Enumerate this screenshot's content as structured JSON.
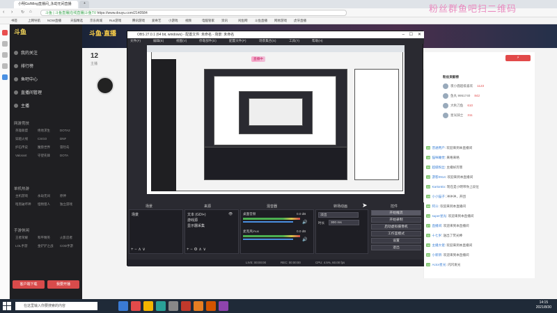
{
  "browser": {
    "tabs": [
      {
        "label": "小明Go/Ming直播间_永劫无间直播",
        "active": true
      },
      {
        "label": "",
        "active": false
      }
    ],
    "url": "https://www.douyu.com/2140584",
    "url_prefix": "斗鱼 | 斗鱼直播|在线直播|斗鱼TV",
    "bookmarks": [
      "书签",
      "上网导航",
      "NOW直播",
      "天猫精选",
      "京东商城",
      "Run游戏",
      "腾讯游戏",
      "爱奇艺",
      "小游戏",
      "视频",
      "电脑管家",
      "资讯",
      "闲鱼网",
      "斗鱼直播",
      "网易游戏",
      "虎牙直播"
    ],
    "watermark": "粉丝群鱼吧扫二维码"
  },
  "sidebar": {
    "items": [
      "我的关注",
      "排行榜",
      "鱼吧中心",
      "直播间管理",
      "主播"
    ],
    "sections": [
      "网游竞技",
      "单机热游",
      "手游休闲"
    ],
    "games_a": [
      "英雄联盟",
      "绝地求生",
      "DOTA2",
      "穿越火线",
      "CSGO",
      "DNF",
      "炉石传说",
      "魔兽世界",
      "冒险岛",
      "Valorant",
      "守望先锋",
      "DOTA"
    ],
    "games_b": [
      "主机游戏",
      "永劫无间",
      "原神",
      "暗黑破坏神",
      "怪物猎人",
      "独立游戏"
    ],
    "games_c": [
      "王者荣耀",
      "和平精英",
      "火影忍者",
      "LOL手游",
      "金铲铲之战",
      "COD手游"
    ],
    "btn_left": "客户端下载",
    "btn_right": "我要开播"
  },
  "page": {
    "banner_logo": "斗鱼·直播",
    "follower_count": "12",
    "streamer_tag": "主播",
    "rank_title": "粉丝贡献榜",
    "rank_rows": [
      "夜小鹿超级喜欢",
      "鱼丸 9951740",
      "大秋刀鱼",
      "星光骑士"
    ],
    "rank_scores": [
      "1123",
      "842",
      "610",
      "311"
    ]
  },
  "chat": {
    "lines": [
      {
        "lvl": "25",
        "name": "普通用户",
        "text": "欢迎来到本直播间"
      },
      {
        "lvl": "18",
        "name": "猫咪睡觉",
        "text": "来咯来咯"
      },
      {
        "lvl": "30",
        "name": "超级粉丝",
        "text": "主播好厉害"
      },
      {
        "lvl": "12",
        "name": "游客0914",
        "text": "欢迎来到本直播间"
      },
      {
        "lvl": "22",
        "name": "KartonEx",
        "text": "现在是小明带你上段位"
      },
      {
        "lvl": "19",
        "name": "小小猫子",
        "text": "冲冲冲，开团"
      },
      {
        "lvl": "08",
        "name": "阿斗",
        "text": "欢迎来到本直播间"
      },
      {
        "lvl": "14",
        "name": "super星光",
        "text": "欢迎来到本直播间"
      },
      {
        "lvl": "27",
        "name": "直播间",
        "text": "欢迎来到本直播间"
      },
      {
        "lvl": "11",
        "name": "十七岁",
        "text": "送出了荧光棒"
      },
      {
        "lvl": "16",
        "name": "主播大佬",
        "text": "欢迎来到本直播间"
      },
      {
        "lvl": "09",
        "name": "小新新",
        "text": "欢迎来到本直播间"
      },
      {
        "lvl": "13",
        "name": "Actor星光",
        "text": "闪闪发光"
      }
    ]
  },
  "obs": {
    "title": "OBS 27.0.1 (64 bit, windows) - 配置文件: 未命名 - 场景: 未命名",
    "menu": [
      "文件(F)",
      "编辑(E)",
      "视图(V)",
      "停靠部件(D)",
      "配置文件(P)",
      "场景集合(S)",
      "工具(T)",
      "帮助(H)"
    ],
    "dock_titles": [
      "场景",
      "来源",
      "混音器",
      "转场动画",
      "控件"
    ],
    "scenes": [
      "场景"
    ],
    "sources": [
      "文本 (GDI+)",
      "游戏源",
      "显示器采集"
    ],
    "mixer": [
      {
        "name": "桌面音频",
        "db": "0.0 dB"
      },
      {
        "name": "麦克风/Aux",
        "db": "0.0 dB"
      }
    ],
    "transition": {
      "type": "淡出",
      "duration_label": "时长",
      "duration": "300 ms"
    },
    "controls": [
      "开始推流",
      "开始录制",
      "启动虚拟摄像机",
      "工作室模式",
      "设置",
      "退出"
    ],
    "status": {
      "live": "LIVE: 00:00:00",
      "rec": "REC: 00:00:00",
      "cpu": "CPU: 4.5%, 60.00 fps"
    }
  },
  "taskbar": {
    "search_placeholder": "在这里输入你要搜索的内容",
    "time": "14:15",
    "date": "2021/8/30"
  }
}
